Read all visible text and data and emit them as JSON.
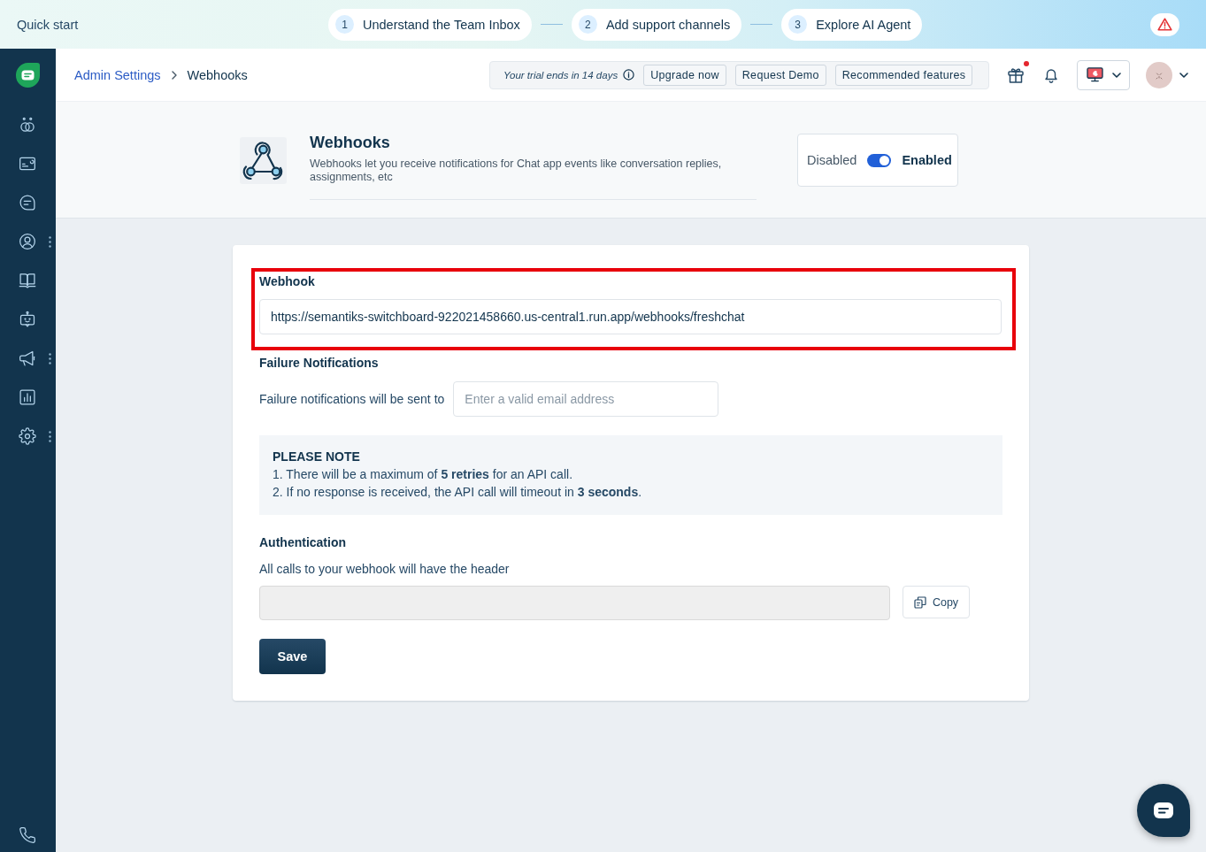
{
  "quick_start": {
    "title": "Quick start",
    "steps": [
      {
        "number": "1",
        "label": "Understand the Team Inbox"
      },
      {
        "number": "2",
        "label": "Add support channels"
      },
      {
        "number": "3",
        "label": "Explore AI Agent"
      }
    ]
  },
  "sidebar": {
    "items": [
      {
        "submenu": false
      },
      {
        "submenu": false
      },
      {
        "submenu": false
      },
      {
        "submenu": true
      },
      {
        "submenu": false
      },
      {
        "submenu": false
      },
      {
        "submenu": true
      },
      {
        "submenu": false
      },
      {
        "submenu": true
      }
    ]
  },
  "header": {
    "breadcrumbs": [
      {
        "label": "Admin Settings",
        "kind": "link"
      },
      {
        "label": "Webhooks",
        "kind": "current"
      }
    ],
    "trial": {
      "text": "Your trial ends in 14 days",
      "buttons": [
        "Upgrade now",
        "Request Demo",
        "Recommended features"
      ]
    },
    "gift_unread": true
  },
  "page_header": {
    "title": "Webhooks",
    "description": "Webhooks let you receive notifications for Chat app events like conversation replies, assignments, etc",
    "toggle": {
      "off_label": "Disabled",
      "on_label": "Enabled",
      "on": true
    }
  },
  "form": {
    "webhook": {
      "label": "Webhook",
      "value": "https://semantiks-switchboard-922021458660.us-central1.run.app/webhooks/freshchat",
      "highlighted": true
    },
    "failure_notifications": {
      "heading": "Failure Notifications",
      "label": "Failure notifications will be sent to",
      "placeholder": "Enter a valid email address"
    },
    "note": {
      "title": "PLEASE NOTE",
      "lines": [
        "1. There will be a maximum of **5 retries** for an API call.",
        "2. If no response is received, the API call will timeout in **3 seconds**."
      ]
    },
    "authentication": {
      "heading": "Authentication",
      "description": "All calls to your webhook will have the header",
      "header_field": {
        "disabled": true
      },
      "copy_button": "Copy"
    },
    "save_button": "Save"
  }
}
